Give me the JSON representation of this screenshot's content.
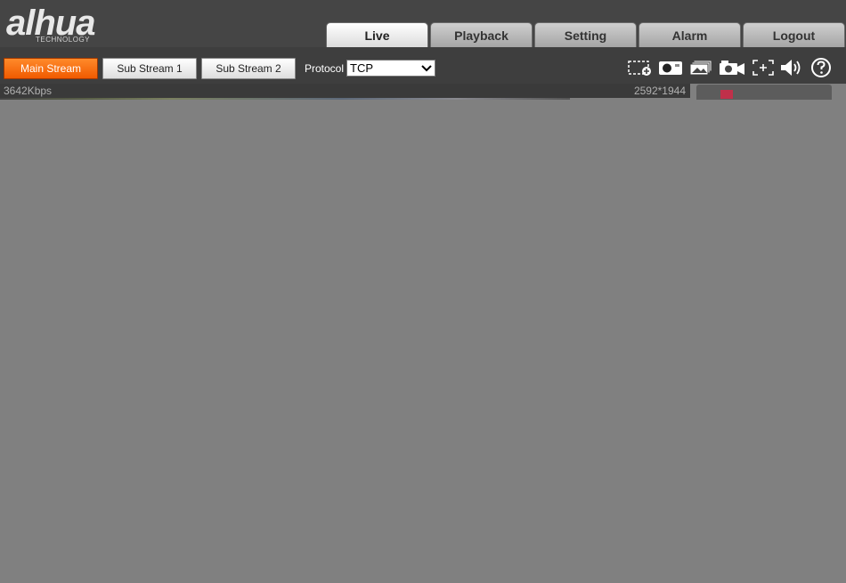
{
  "logo": {
    "text": "alhua",
    "subtext": "TECHNOLOGY"
  },
  "tabs": [
    {
      "label": "Live",
      "active": true
    },
    {
      "label": "Playback",
      "active": false
    },
    {
      "label": "Setting",
      "active": false
    },
    {
      "label": "Alarm",
      "active": false
    },
    {
      "label": "Logout",
      "active": false
    }
  ],
  "toolbar": {
    "streams": [
      {
        "label": "Main Stream",
        "selected": true
      },
      {
        "label": "Sub Stream 1",
        "selected": false
      },
      {
        "label": "Sub Stream 2",
        "selected": false
      }
    ],
    "protocol_label": "Protocol",
    "protocol_value": "TCP",
    "icons": [
      "zoom-region-icon",
      "snapshot-icon",
      "triple-snapshot-icon",
      "record-icon",
      "fullscreen-icon",
      "audio-icon",
      "help-icon"
    ]
  },
  "status": {
    "bitrate": "3642Kbps",
    "resolution": "2592*1944"
  },
  "colors": {
    "accent": "#f26a10",
    "header_bg": "#454545",
    "toolbar_bg": "#3e3e3e",
    "video_bg": "#808080"
  }
}
